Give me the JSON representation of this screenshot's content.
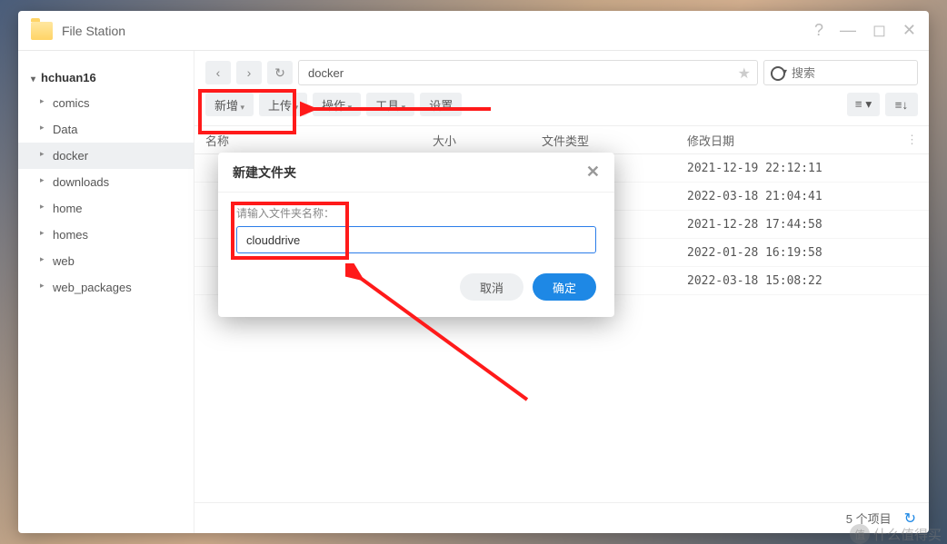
{
  "app": {
    "title": "File Station"
  },
  "sidebar": {
    "root": "hchuan16",
    "items": [
      {
        "label": "comics"
      },
      {
        "label": "Data"
      },
      {
        "label": "docker",
        "active": true
      },
      {
        "label": "downloads"
      },
      {
        "label": "home"
      },
      {
        "label": "homes"
      },
      {
        "label": "web"
      },
      {
        "label": "web_packages"
      }
    ]
  },
  "toolbar": {
    "path": "docker",
    "search_placeholder": "搜索",
    "buttons": {
      "new": "新增",
      "upload": "上传",
      "action": "操作",
      "tool": "工具",
      "settings": "设置"
    }
  },
  "table": {
    "headers": {
      "name": "名称",
      "size": "大小",
      "type": "文件类型",
      "date": "修改日期"
    },
    "rows": [
      {
        "name": "",
        "size": "",
        "type": "",
        "date": "2021-12-19 22:12:11"
      },
      {
        "name": "",
        "size": "",
        "type": "",
        "date": "2022-03-18 21:04:41"
      },
      {
        "name": "",
        "size": "",
        "type": "",
        "date": "2021-12-28 17:44:58"
      },
      {
        "name": "",
        "size": "",
        "type": "",
        "date": "2022-01-28 16:19:58"
      },
      {
        "name": "",
        "size": "",
        "type": "",
        "date": "2022-03-18 15:08:22"
      }
    ]
  },
  "status": {
    "count": "5 个项目"
  },
  "dialog": {
    "title": "新建文件夹",
    "label": "请输入文件夹名称：",
    "value": "clouddrive",
    "cancel": "取消",
    "ok": "确定"
  },
  "watermark": "值|什么值得买"
}
